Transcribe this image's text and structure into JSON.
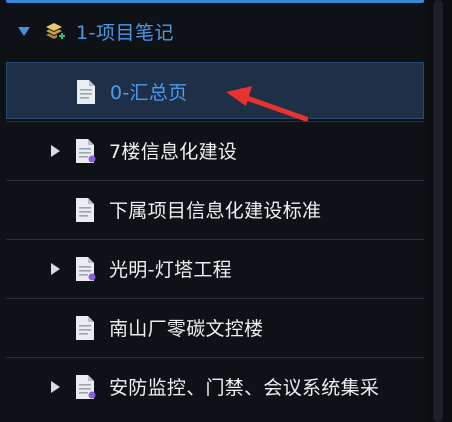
{
  "tree": {
    "root": {
      "label": "1-项目笔记",
      "expand_icon": "caret-down-icon",
      "icon": "layers-add-icon"
    },
    "items": [
      {
        "label": "0-汇总页",
        "icon": "document-icon",
        "expandable": false,
        "selected": true
      },
      {
        "label": "7楼信息化建设",
        "icon": "document-icon",
        "expandable": true,
        "selected": false
      },
      {
        "label": "下属项目信息化建设标准",
        "icon": "document-icon",
        "expandable": false,
        "selected": false
      },
      {
        "label": "光明-灯塔工程",
        "icon": "document-icon",
        "expandable": true,
        "selected": false
      },
      {
        "label": "南山厂零碳文控楼",
        "icon": "document-icon",
        "expandable": false,
        "selected": false
      },
      {
        "label": "安防监控、门禁、会议系统集采",
        "icon": "document-icon",
        "expandable": true,
        "selected": false
      }
    ]
  },
  "annotation": {
    "icon": "red-arrow-icon",
    "color": "#e8322d"
  },
  "colors": {
    "accent": "#4e98ea",
    "background": "#0e1116",
    "selected_row": "#1e2f48",
    "text": "#eef0f3"
  }
}
